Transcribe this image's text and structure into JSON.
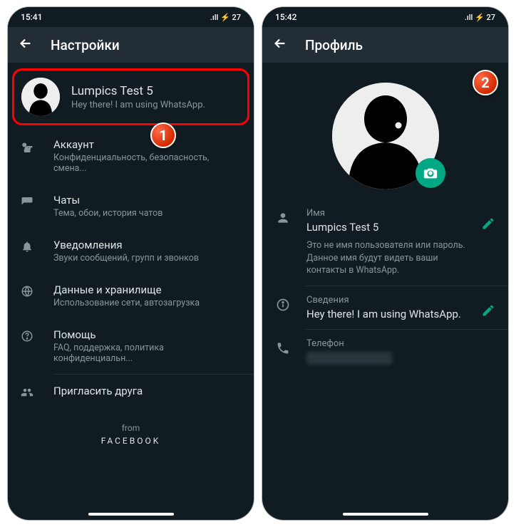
{
  "left": {
    "status_time": "15:41",
    "status_icons": ".ıll ⚡ 27",
    "header_title": "Настройки",
    "profile": {
      "name": "Lumpics Test 5",
      "status": "Hey there! I am using WhatsApp."
    },
    "items": [
      {
        "icon": "key",
        "label": "Аккаунт",
        "desc": "Конфиденциальность, безопасность, смена..."
      },
      {
        "icon": "chat",
        "label": "Чаты",
        "desc": "Тема, обои, история чатов"
      },
      {
        "icon": "bell",
        "label": "Уведомления",
        "desc": "Звуки сообщений, групп и звонков"
      },
      {
        "icon": "data",
        "label": "Данные и хранилище",
        "desc": "Использование сети, автозагрузка"
      },
      {
        "icon": "help",
        "label": "Помощь",
        "desc": "FAQ, поддержка, политика конфиденциальн..."
      },
      {
        "icon": "people",
        "label": "Пригласить друга",
        "desc": ""
      }
    ],
    "footer_from": "from",
    "footer_fb": "FACEBOOK"
  },
  "right": {
    "status_time": "15:42",
    "status_icons": ".ıll ⚡ 27",
    "header_title": "Профиль",
    "name_label": "Имя",
    "name_value": "Lumpics Test 5",
    "name_note": "Это не имя пользователя или пароль. Данное имя будут видеть ваши контакты в WhatsApp.",
    "about_label": "Сведения",
    "about_value": "Hey there! I am using WhatsApp.",
    "phone_label": "Телефон"
  },
  "badges": {
    "one": "1",
    "two": "2"
  }
}
